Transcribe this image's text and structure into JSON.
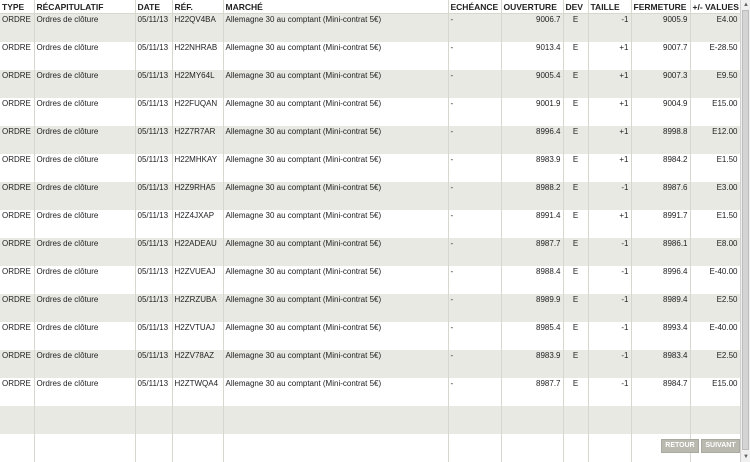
{
  "table": {
    "headers": {
      "type": "TYPE",
      "summary": "RÉCAPITULATIF",
      "date": "DATE",
      "ref": "RÉF.",
      "market": "MARCHÉ",
      "expiry": "ECHÉANCE",
      "open": "OUVERTURE",
      "currency": "DEV",
      "size": "TAILLE",
      "close": "FERMETURE",
      "pnl": "+/- VALUES"
    },
    "rows": [
      {
        "type": "ORDRE",
        "summary": "Ordres de clôture",
        "date": "05/11/13",
        "ref": "H22QV4BA",
        "market": "Allemagne 30 au comptant (Mini-contrat 5€)",
        "expiry": "-",
        "open": "9006.7",
        "currency": "E",
        "size": "-1",
        "close": "9005.9",
        "pnl": "E4.00"
      },
      {
        "type": "ORDRE",
        "summary": "Ordres de clôture",
        "date": "05/11/13",
        "ref": "H22NHRAB",
        "market": "Allemagne 30 au comptant (Mini-contrat 5€)",
        "expiry": "-",
        "open": "9013.4",
        "currency": "E",
        "size": "+1",
        "close": "9007.7",
        "pnl": "E-28.50"
      },
      {
        "type": "ORDRE",
        "summary": "Ordres de clôture",
        "date": "05/11/13",
        "ref": "H22MY64L",
        "market": "Allemagne 30 au comptant (Mini-contrat 5€)",
        "expiry": "-",
        "open": "9005.4",
        "currency": "E",
        "size": "+1",
        "close": "9007.3",
        "pnl": "E9.50"
      },
      {
        "type": "ORDRE",
        "summary": "Ordres de clôture",
        "date": "05/11/13",
        "ref": "H22FUQAN",
        "market": "Allemagne 30 au comptant (Mini-contrat 5€)",
        "expiry": "-",
        "open": "9001.9",
        "currency": "E",
        "size": "+1",
        "close": "9004.9",
        "pnl": "E15.00"
      },
      {
        "type": "ORDRE",
        "summary": "Ordres de clôture",
        "date": "05/11/13",
        "ref": "H2Z7R7AR",
        "market": "Allemagne 30 au comptant (Mini-contrat 5€)",
        "expiry": "-",
        "open": "8996.4",
        "currency": "E",
        "size": "+1",
        "close": "8998.8",
        "pnl": "E12.00"
      },
      {
        "type": "ORDRE",
        "summary": "Ordres de clôture",
        "date": "05/11/13",
        "ref": "H22MHKAY",
        "market": "Allemagne 30 au comptant (Mini-contrat 5€)",
        "expiry": "-",
        "open": "8983.9",
        "currency": "E",
        "size": "+1",
        "close": "8984.2",
        "pnl": "E1.50"
      },
      {
        "type": "ORDRE",
        "summary": "Ordres de clôture",
        "date": "05/11/13",
        "ref": "H2Z9RHA5",
        "market": "Allemagne 30 au comptant (Mini-contrat 5€)",
        "expiry": "-",
        "open": "8988.2",
        "currency": "E",
        "size": "-1",
        "close": "8987.6",
        "pnl": "E3.00"
      },
      {
        "type": "ORDRE",
        "summary": "Ordres de clôture",
        "date": "05/11/13",
        "ref": "H2Z4JXAP",
        "market": "Allemagne 30 au comptant (Mini-contrat 5€)",
        "expiry": "-",
        "open": "8991.4",
        "currency": "E",
        "size": "+1",
        "close": "8991.7",
        "pnl": "E1.50"
      },
      {
        "type": "ORDRE",
        "summary": "Ordres de clôture",
        "date": "05/11/13",
        "ref": "H22ADEAU",
        "market": "Allemagne 30 au comptant (Mini-contrat 5€)",
        "expiry": "-",
        "open": "8987.7",
        "currency": "E",
        "size": "-1",
        "close": "8986.1",
        "pnl": "E8.00"
      },
      {
        "type": "ORDRE",
        "summary": "Ordres de clôture",
        "date": "05/11/13",
        "ref": "H2ZVUEAJ",
        "market": "Allemagne 30 au comptant (Mini-contrat 5€)",
        "expiry": "-",
        "open": "8988.4",
        "currency": "E",
        "size": "-1",
        "close": "8996.4",
        "pnl": "E-40.00"
      },
      {
        "type": "ORDRE",
        "summary": "Ordres de clôture",
        "date": "05/11/13",
        "ref": "H2ZRZUBA",
        "market": "Allemagne 30 au comptant (Mini-contrat 5€)",
        "expiry": "-",
        "open": "8989.9",
        "currency": "E",
        "size": "-1",
        "close": "8989.4",
        "pnl": "E2.50"
      },
      {
        "type": "ORDRE",
        "summary": "Ordres de clôture",
        "date": "05/11/13",
        "ref": "H2ZVTUAJ",
        "market": "Allemagne 30 au comptant (Mini-contrat 5€)",
        "expiry": "-",
        "open": "8985.4",
        "currency": "E",
        "size": "-1",
        "close": "8993.4",
        "pnl": "E-40.00"
      },
      {
        "type": "ORDRE",
        "summary": "Ordres de clôture",
        "date": "05/11/13",
        "ref": "H2ZV78AZ",
        "market": "Allemagne 30 au comptant (Mini-contrat 5€)",
        "expiry": "-",
        "open": "8983.9",
        "currency": "E",
        "size": "-1",
        "close": "8983.4",
        "pnl": "E2.50"
      },
      {
        "type": "ORDRE",
        "summary": "Ordres de clôture",
        "date": "05/11/13",
        "ref": "H2ZTWQA4",
        "market": "Allemagne 30 au comptant (Mini-contrat 5€)",
        "expiry": "-",
        "open": "8987.7",
        "currency": "E",
        "size": "-1",
        "close": "8984.7",
        "pnl": "E15.00"
      }
    ]
  },
  "pager": {
    "prev_label": "RETOUR",
    "next_label": "SUIVANT"
  },
  "scrollbar": {
    "up_icon": "triangle-up-icon",
    "down_icon": "triangle-down-icon"
  }
}
